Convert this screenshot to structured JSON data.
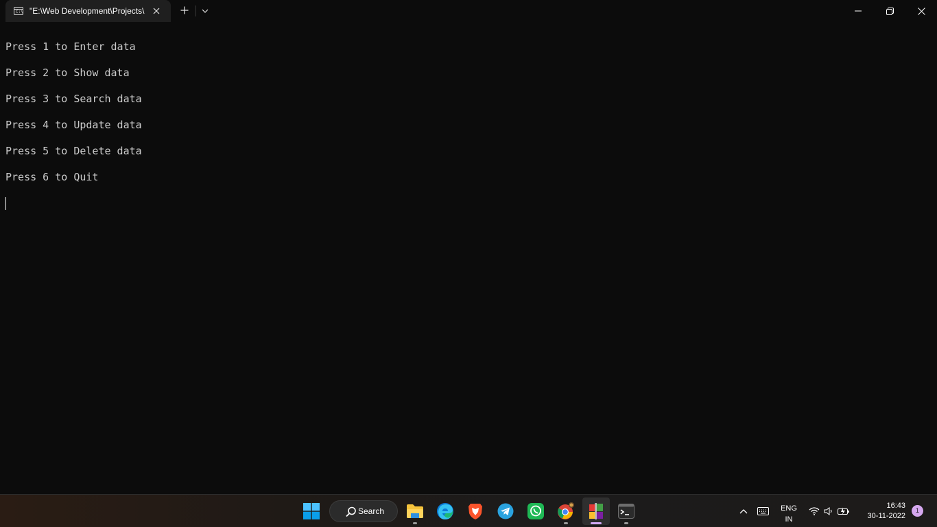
{
  "window": {
    "tab_title": "\"E:\\Web Development\\Projects\\",
    "tab_icon_text": "C:\\"
  },
  "terminal": {
    "lines": [
      "Press 1 to Enter data",
      "Press 2 to Show data",
      "Press 3 to Search data",
      "Press 4 to Update data",
      "Press 5 to Delete data",
      "Press 6 to Quit"
    ]
  },
  "taskbar": {
    "search_label": "Search",
    "apps": [
      {
        "icon": "start-windows-icon"
      },
      {
        "icon": "file-explorer-icon"
      },
      {
        "icon": "edge-browser-icon"
      },
      {
        "icon": "brave-browser-icon"
      },
      {
        "icon": "telegram-icon"
      },
      {
        "icon": "whatsapp-icon"
      },
      {
        "icon": "chrome-browser-icon"
      },
      {
        "icon": "winrar-icon"
      },
      {
        "icon": "terminal-icon"
      }
    ],
    "tray": {
      "language": "ENG",
      "region": "IN",
      "time": "16:43",
      "date": "30-11-2022",
      "notification_count": "1"
    }
  },
  "colors": {
    "terminal_bg": "#0c0c0c",
    "terminal_fg": "#cccccc",
    "tab_bg": "#1f1f1f",
    "taskbar_bg": "#1c1b1b",
    "accent_indicator": "#d0a8f4"
  }
}
